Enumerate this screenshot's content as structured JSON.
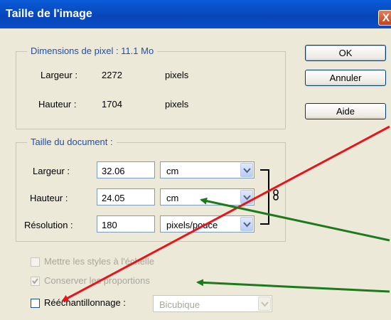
{
  "window": {
    "title": "Taille de l'image",
    "close_glyph": "X"
  },
  "pixel_dimensions": {
    "legend": "Dimensions de pixel : 11.1 Mo",
    "width_label": "Largeur :",
    "width_value": "2272",
    "width_unit": "pixels",
    "height_label": "Hauteur :",
    "height_value": "1704",
    "height_unit": "pixels"
  },
  "buttons": {
    "ok": "OK",
    "cancel": "Annuler",
    "help": "Aide"
  },
  "document_size": {
    "legend": "Taille du document :",
    "width_label": "Largeur :",
    "width_value": "32.06",
    "width_unit": "cm",
    "height_label": "Hauteur :",
    "height_value": "24.05",
    "height_unit": "cm",
    "resolution_label": "Résolution :",
    "resolution_value": "180",
    "resolution_unit": "pixels/pouce"
  },
  "options": {
    "scale_styles": {
      "label": "Mettre les styles à l'échelle",
      "checked": false,
      "enabled": false
    },
    "constrain_proportions": {
      "label": "Conserver les proportions",
      "checked": true,
      "enabled": false
    },
    "resample": {
      "label": "Rééchantillonnage :",
      "checked": false,
      "enabled": true
    },
    "resample_method": {
      "value": "Bicubique",
      "enabled": false
    }
  },
  "annotation_colors": {
    "red": "#e8141b",
    "green": "#1c7a1c"
  }
}
